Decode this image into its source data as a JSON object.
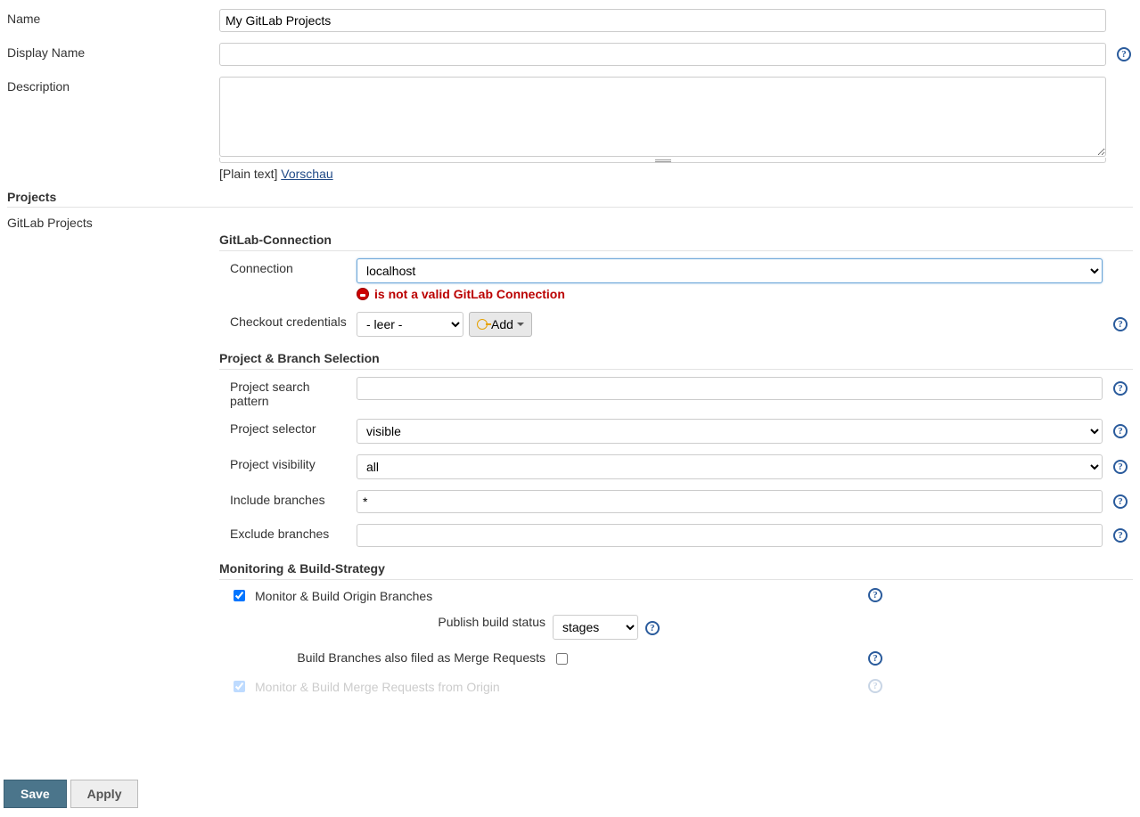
{
  "top": {
    "name_label": "Name",
    "name_value": "My GitLab Projects",
    "display_name_label": "Display Name",
    "display_name_value": "",
    "description_label": "Description",
    "description_value": "",
    "plain_text": "[Plain text]",
    "preview_link": "Vorschau"
  },
  "projects_header": "Projects",
  "projects_type": "GitLab Projects",
  "gitlab": {
    "section_title": "GitLab-Connection",
    "connection_label": "Connection",
    "connection_value": "localhost",
    "connection_error": "is not a valid GitLab Connection",
    "credentials_label": "Checkout credentials",
    "credentials_value": "- leer -",
    "add_button": "Add"
  },
  "branch": {
    "section_title": "Project & Branch Selection",
    "search_pattern_label": "Project search pattern",
    "search_pattern_value": "",
    "selector_label": "Project selector",
    "selector_value": "visible",
    "visibility_label": "Project visibility",
    "visibility_value": "all",
    "include_label": "Include branches",
    "include_value": "*",
    "exclude_label": "Exclude branches",
    "exclude_value": ""
  },
  "monitor": {
    "section_title": "Monitoring & Build-Strategy",
    "origin_cb_label": "Monitor & Build Origin Branches",
    "origin_checked": true,
    "publish_label": "Publish build status",
    "publish_value": "stages",
    "also_mr_label": "Build Branches also filed as Merge Requests",
    "also_mr_checked": false,
    "merge_origin_label": "Monitor & Build Merge Requests from Origin"
  },
  "buttons": {
    "save": "Save",
    "apply": "Apply"
  },
  "help_icon_label": "?"
}
